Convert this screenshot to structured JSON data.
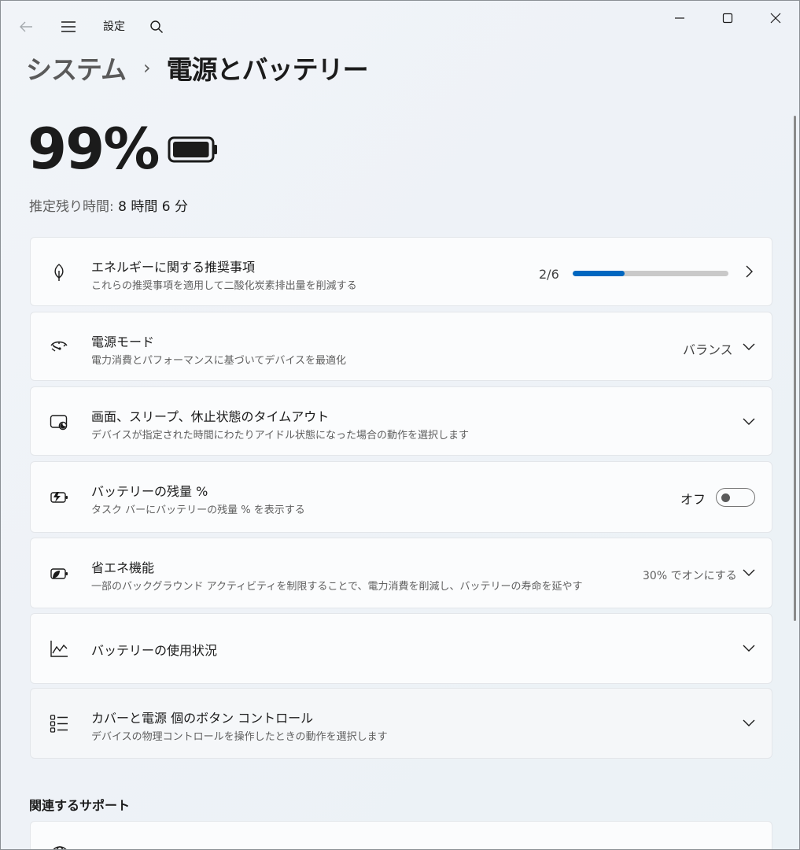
{
  "window": {
    "app_title": "設定",
    "controls": {
      "minimize": "—",
      "maximize": "☐",
      "close": "✕"
    }
  },
  "breadcrumb": {
    "parent": "システム",
    "separator": "›",
    "current": "電源とバッテリー"
  },
  "battery": {
    "percent_label": "99%",
    "level": 0.99,
    "estimate_label": "推定残り時間:",
    "estimate_value": "8 時間 6 分"
  },
  "cards": {
    "energy": {
      "title": "エネルギーに関する推奨事項",
      "subtitle": "これらの推奨事項を適用して二酸化炭素排出量を削減する",
      "progress_text": "2/6",
      "progress_fraction": 0.333,
      "icon": "leaf-icon"
    },
    "power_mode": {
      "title": "電源モード",
      "subtitle": "電力消費とパフォーマンスに基づいてデバイスを最適化",
      "value": "バランス",
      "icon": "gauge-icon"
    },
    "screen_sleep": {
      "title": "画面、スリープ、休止状態のタイムアウト",
      "subtitle": "デバイスが指定された時間にわたりアイドル状態になった場合の動作を選択します",
      "icon": "screen-sleep-icon"
    },
    "battery_percent": {
      "title": "バッテリーの残量 %",
      "subtitle": "タスク バーにバッテリーの残量 % を表示する",
      "toggle_label": "オフ",
      "toggle_on": false,
      "icon": "battery-charging-icon"
    },
    "energy_saver": {
      "title": "省エネ機能",
      "subtitle": "一部のバックグラウンド アクティビティを制限することで、電力消費を削減し、バッテリーの寿命を延やす",
      "value": "30% でオンにする",
      "icon": "energy-saver-icon"
    },
    "battery_usage": {
      "title": "バッテリーの使用状況",
      "icon": "chart-line-icon"
    },
    "lid_buttons": {
      "title": "カバーと電源 個のボタン コントロール",
      "subtitle": "デバイスの物理コントロールを操作したときの動作を選択します",
      "icon": "list-icon"
    }
  },
  "related_support": {
    "title": "関連するサポート",
    "icon": "globe-icon"
  },
  "colors": {
    "accent": "#0067c0",
    "track": "#c9c9c9",
    "card": "#fbfcfd"
  }
}
